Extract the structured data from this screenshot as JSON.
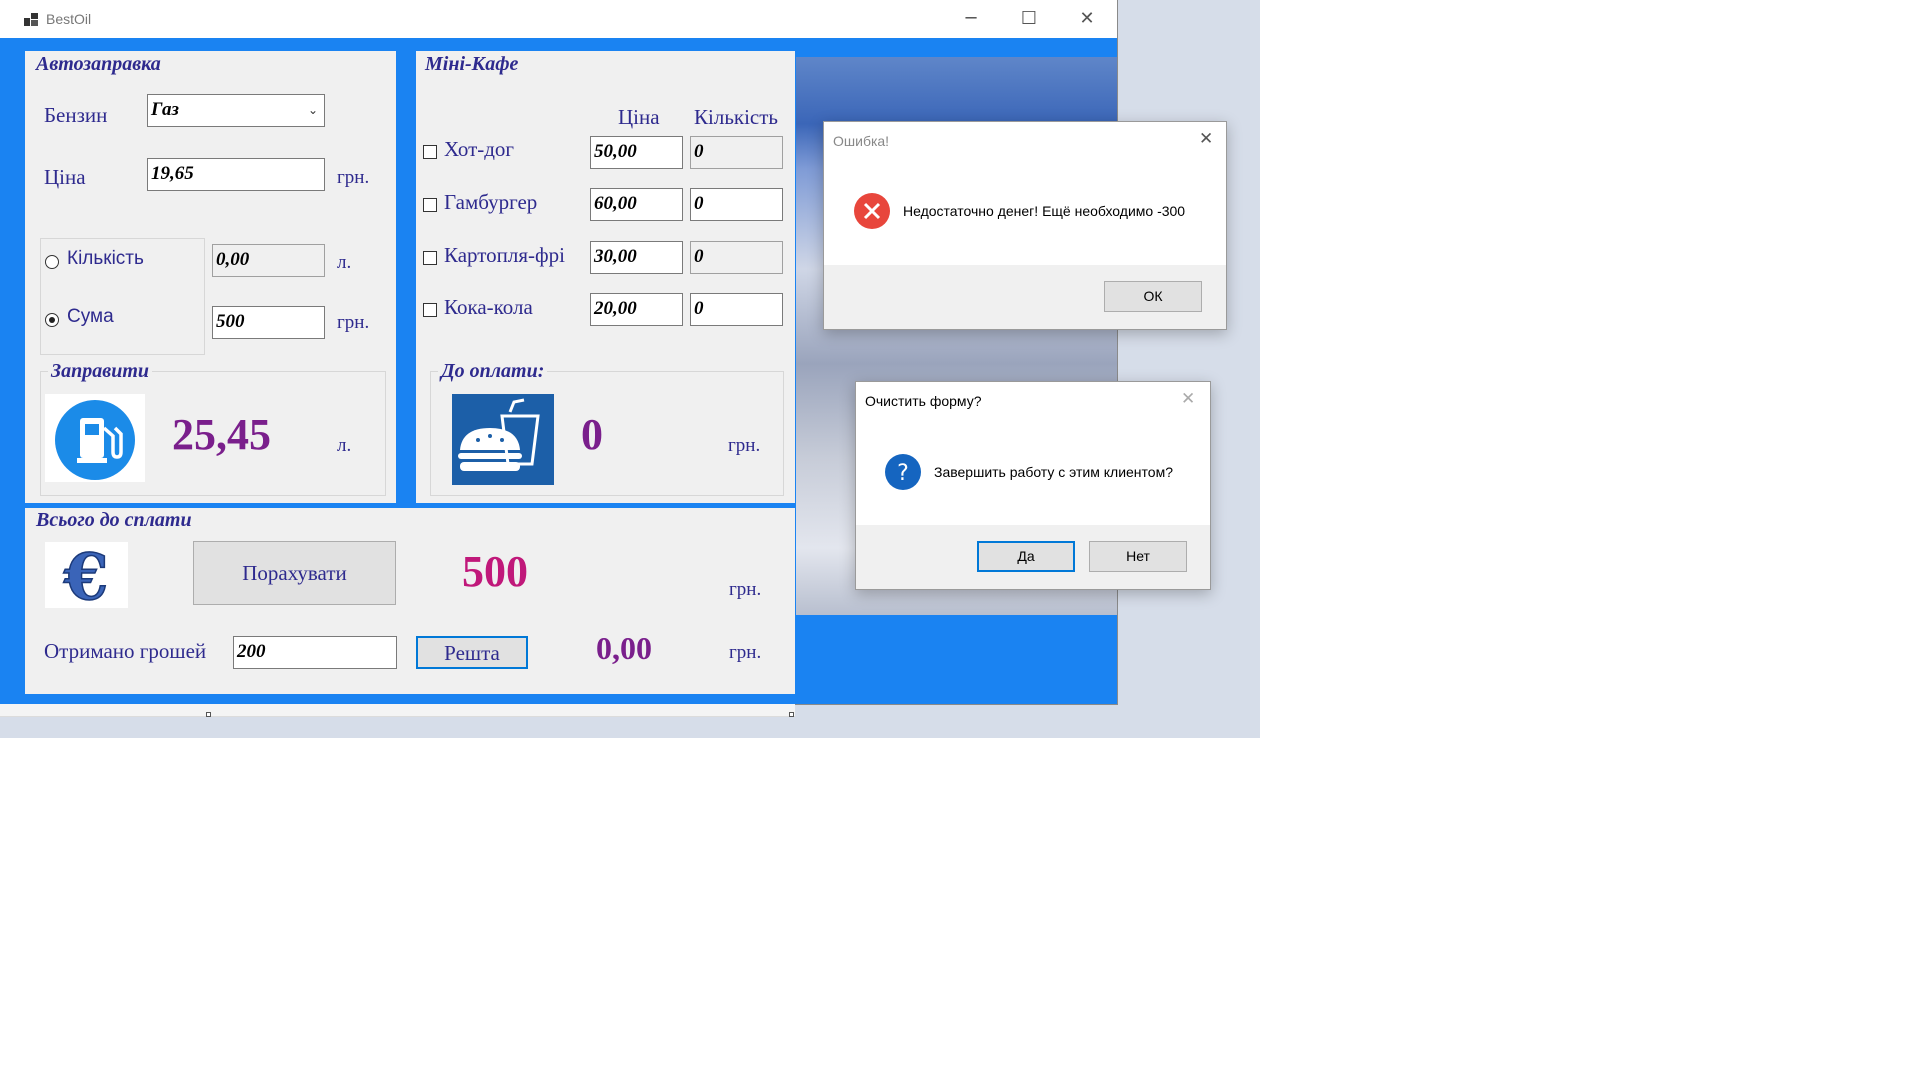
{
  "window": {
    "title": "BestOil",
    "minimize_glyph": "─",
    "maximize_glyph": "☐",
    "close_glyph": "✕"
  },
  "fuel": {
    "group_title": "Автозаправка",
    "fuel_label": "Бензин",
    "fuel_selected": "Газ",
    "price_label": "Ціна",
    "price_value": "19,65",
    "price_unit": "грн.",
    "quantity_label": "Кількість",
    "quantity_value": "0,00",
    "quantity_unit": "л.",
    "sum_label": "Сума",
    "sum_value": "500",
    "sum_unit": "грн.",
    "selected_mode": "Сума",
    "refuel_title": "Заправити",
    "refuel_value": "25,45",
    "refuel_unit": "л.",
    "icon": "fuel-pump-icon"
  },
  "cafe": {
    "group_title": "Міні-Кафе",
    "col_price": "Ціна",
    "col_qty": "Кількість",
    "items": [
      {
        "name": "Хот-дог",
        "price": "50,00",
        "qty": "0",
        "checked": false
      },
      {
        "name": "Гамбургер",
        "price": "60,00",
        "qty": "0",
        "checked": false
      },
      {
        "name": "Картопля-фрі",
        "price": "30,00",
        "qty": "0",
        "checked": false
      },
      {
        "name": "Кока-кола",
        "price": "20,00",
        "qty": "0",
        "checked": false
      }
    ],
    "pay_title": "До оплати:",
    "pay_value": "0",
    "pay_unit": "грн.",
    "icon": "fast-food-icon"
  },
  "total": {
    "group_title": "Всього до сплати",
    "calc_button": "Порахувати",
    "total_value": "500",
    "total_unit": "грн.",
    "received_label": "Отримано грошей",
    "received_value": "200",
    "change_button": "Решта",
    "change_value": "0,00",
    "change_unit": "грн.",
    "icon": "euro-icon"
  },
  "error_dialog": {
    "title": "Ошибка!",
    "message": "Недостаточно денег! Ещё необходимо -300",
    "ok_button": "ОК",
    "icon": "error-icon"
  },
  "confirm_dialog": {
    "title": "Очистить форму?",
    "message": "Завершить работу с этим клиентом?",
    "yes_button": "Да",
    "no_button": "Нет",
    "icon": "question-icon"
  },
  "colors": {
    "accent_blue": "#1a83f2",
    "label_text": "#2e2a8e",
    "value_purple": "#7a1f8c",
    "total_magenta": "#c0187a"
  }
}
